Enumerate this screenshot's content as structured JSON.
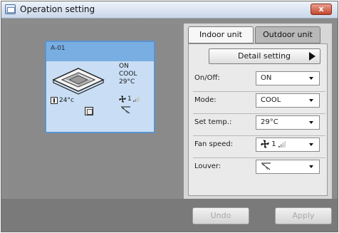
{
  "window": {
    "title": "Operation setting",
    "close_label": "x"
  },
  "unit_card": {
    "name": "A-01",
    "status": {
      "power": "ON",
      "mode": "COOL",
      "set_temp": "29°C"
    },
    "room_temp": "24°c",
    "fan_level": "1",
    "icons": {
      "unit": "ceiling-cassette-icon",
      "thermometer": "thermometer-icon",
      "filter": "filter-icon",
      "fan": "fan-icon",
      "louver": "louver-icon"
    }
  },
  "tabs": [
    {
      "label": "Indoor unit",
      "active": true
    },
    {
      "label": "Outdoor unit",
      "active": false
    }
  ],
  "detail_setting": {
    "label": "Detail setting"
  },
  "settings": {
    "onoff": {
      "label": "On/Off:",
      "value": "ON"
    },
    "mode": {
      "label": "Mode:",
      "value": "COOL"
    },
    "set_temp": {
      "label": "Set temp.:",
      "value": "29°C"
    },
    "fan_speed": {
      "label": "Fan speed:",
      "value": "1"
    },
    "louver": {
      "label": "Louver:",
      "value": ""
    }
  },
  "footer": {
    "undo_label": "Undo",
    "apply_label": "Apply"
  },
  "colors": {
    "card_border": "#5b94cf",
    "card_header": "#79aee2",
    "card_body": "#c9def4",
    "close_button": "#c2462f"
  }
}
